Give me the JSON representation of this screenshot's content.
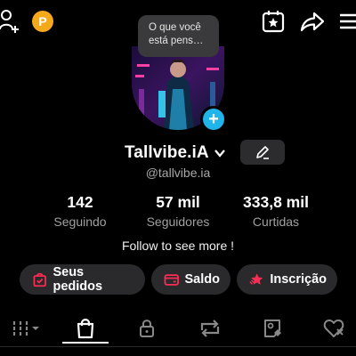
{
  "header": {
    "coin_label": "P",
    "icons": [
      "add-user-icon",
      "coin-icon",
      "calendar-star-icon",
      "share-icon",
      "menu-icon"
    ]
  },
  "note_bubble": {
    "text": "O que você está pens…"
  },
  "profile": {
    "username": "Tallvibe.iA",
    "handle": "@tallvibe.ia",
    "bio": "Follow to see more !"
  },
  "stats": [
    {
      "value": "142",
      "label": "Seguindo"
    },
    {
      "value": "57 mil",
      "label": "Seguidores"
    },
    {
      "value": "333,8 mil",
      "label": "Curtidas"
    }
  ],
  "actions": [
    {
      "label": "Seus pedidos",
      "icon": "shopping-bag-icon"
    },
    {
      "label": "Saldo",
      "icon": "wallet-icon"
    },
    {
      "label": "Inscrição",
      "icon": "subscription-star-icon"
    }
  ],
  "tabs": [
    "grid-icon",
    "shop-icon",
    "lock-icon",
    "repost-icon",
    "tagged-icon",
    "liked-icon"
  ],
  "colors": {
    "background": "#000000",
    "pill": "#2a2a2c",
    "accent_red": "#fe2c55",
    "accent_blue": "#1fb5ea",
    "coin": "#f4a91b",
    "muted_text": "#a0a0a0"
  }
}
